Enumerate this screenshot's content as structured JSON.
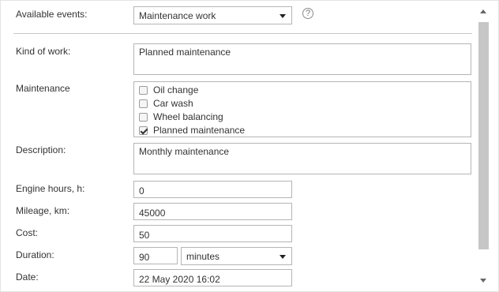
{
  "available_events": {
    "label": "Available events:",
    "value": "Maintenance work",
    "help_glyph": "?"
  },
  "kind_of_work": {
    "label": "Kind of work:",
    "value": "Planned maintenance"
  },
  "maintenance": {
    "label": "Maintenance",
    "options": [
      {
        "label": "Oil change",
        "checked": false
      },
      {
        "label": "Car wash",
        "checked": false
      },
      {
        "label": "Wheel balancing",
        "checked": false
      },
      {
        "label": "Planned maintenance",
        "checked": true
      }
    ]
  },
  "description": {
    "label": "Description:",
    "value": "Monthly maintenance"
  },
  "engine_hours": {
    "label": "Engine hours, h:",
    "value": "0"
  },
  "mileage": {
    "label": "Mileage, km:",
    "value": "45000"
  },
  "cost": {
    "label": "Cost:",
    "value": "50"
  },
  "duration": {
    "label": "Duration:",
    "value": "90",
    "unit": "minutes"
  },
  "date": {
    "label": "Date:",
    "value": "22 May 2020 16:02"
  }
}
